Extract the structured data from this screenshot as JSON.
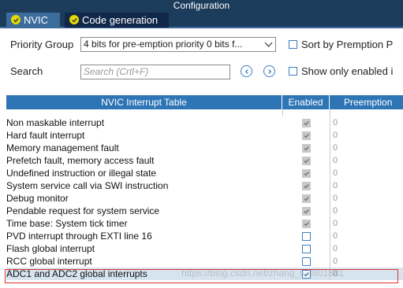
{
  "window": {
    "title": "Configuration"
  },
  "tabs": [
    {
      "label": "NVIC",
      "active": true
    },
    {
      "label": "Code generation",
      "active": false
    }
  ],
  "controls": {
    "priority_group_label": "Priority Group",
    "priority_group_value": "4 bits for pre-emption priority 0 bits f...",
    "sort_label": "Sort by Premption P",
    "sort_checked": false,
    "search_label": "Search",
    "search_placeholder": "Search (Crtl+F)",
    "show_enabled_label": "Show only enabled i",
    "show_enabled_checked": false
  },
  "table": {
    "headers": {
      "name": "NVIC Interrupt Table",
      "enabled": "Enabled",
      "preemption": "Preemption"
    },
    "rows": [
      {
        "name": "Non maskable interrupt",
        "enabled": true,
        "locked": true,
        "priority": "0"
      },
      {
        "name": "Hard fault interrupt",
        "enabled": true,
        "locked": true,
        "priority": "0"
      },
      {
        "name": "Memory management fault",
        "enabled": true,
        "locked": true,
        "priority": "0"
      },
      {
        "name": "Prefetch fault, memory access fault",
        "enabled": true,
        "locked": true,
        "priority": "0"
      },
      {
        "name": "Undefined instruction or illegal state",
        "enabled": true,
        "locked": true,
        "priority": "0"
      },
      {
        "name": "System service call via SWI instruction",
        "enabled": true,
        "locked": true,
        "priority": "0"
      },
      {
        "name": "Debug monitor",
        "enabled": true,
        "locked": true,
        "priority": "0"
      },
      {
        "name": "Pendable request for system service",
        "enabled": true,
        "locked": true,
        "priority": "0"
      },
      {
        "name": "Time base: System tick timer",
        "enabled": true,
        "locked": true,
        "priority": "0"
      },
      {
        "name": "PVD interrupt through EXTI line 16",
        "enabled": false,
        "locked": false,
        "priority": "0"
      },
      {
        "name": "Flash global interrupt",
        "enabled": false,
        "locked": false,
        "priority": "0"
      },
      {
        "name": "RCC global interrupt",
        "enabled": false,
        "locked": false,
        "priority": "0"
      },
      {
        "name": "ADC1 and ADC2 global interrupts",
        "enabled": true,
        "locked": false,
        "priority": "0",
        "selected": true
      }
    ]
  },
  "watermark": "https://blog.csdn.net/zhang_lu3601881",
  "colors": {
    "title_bar": "#1c3c5c",
    "tab_active": "#3c6c9c",
    "table_header": "#2e75b6",
    "highlight_border": "#e03030"
  }
}
